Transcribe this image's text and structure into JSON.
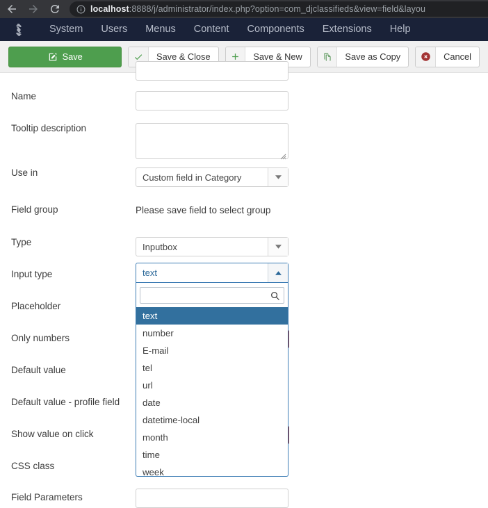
{
  "browser": {
    "back_icon": "back-arrow-icon",
    "forward_icon": "forward-arrow-icon",
    "reload_icon": "reload-icon",
    "info_icon": "info-circle-icon",
    "url_host": "localhost",
    "url_rest": ":8888/j/administrator/index.php?option=com_djclassifieds&view=field&layou"
  },
  "admin_menu": {
    "logo": "joomla-logo-icon",
    "items": [
      {
        "label": "System"
      },
      {
        "label": "Users"
      },
      {
        "label": "Menus"
      },
      {
        "label": "Content"
      },
      {
        "label": "Components"
      },
      {
        "label": "Extensions"
      },
      {
        "label": "Help"
      }
    ]
  },
  "toolbar": {
    "save_label": "Save",
    "save_close_label": "Save & Close",
    "save_new_label": "Save & New",
    "save_copy_label": "Save as Copy",
    "cancel_label": "Cancel",
    "save_icon": "pencil-square-icon",
    "save_close_icon": "check-icon",
    "save_new_icon": "plus-icon",
    "save_copy_icon": "copy-icon",
    "cancel_icon": "cancel-circle-icon",
    "save_color": "#4e9e4e",
    "cancel_color": "#a33434"
  },
  "form": {
    "rows": [
      {
        "label": "Name",
        "value": ""
      },
      {
        "label": "Tooltip description",
        "value": ""
      },
      {
        "label": "Use in",
        "value": "Custom field in Category"
      },
      {
        "label": "Field group",
        "note": "Please save field to select group"
      },
      {
        "label": "Type",
        "value": "Inputbox"
      },
      {
        "label": "Input type",
        "value": "text"
      },
      {
        "label": "Placeholder",
        "value": ""
      },
      {
        "label": "Only numbers",
        "value": ""
      },
      {
        "label": "Default value",
        "value": ""
      },
      {
        "label": "Default value - profile field",
        "value": ""
      },
      {
        "label": "Show value on click",
        "value": ""
      },
      {
        "label": "CSS class",
        "value": ""
      },
      {
        "label": "Field Parameters",
        "value": ""
      }
    ]
  },
  "input_type_dropdown": {
    "selected": "text",
    "search_value": "",
    "search_placeholder": "",
    "search_icon": "magnifier-icon",
    "arrow_icon": "chevron-up-icon",
    "highlight_color": "#32709e",
    "options": [
      {
        "label": "text",
        "selected": true
      },
      {
        "label": "number",
        "selected": false
      },
      {
        "label": "E-mail",
        "selected": false
      },
      {
        "label": "tel",
        "selected": false
      },
      {
        "label": "url",
        "selected": false
      },
      {
        "label": "date",
        "selected": false
      },
      {
        "label": "datetime-local",
        "selected": false
      },
      {
        "label": "month",
        "selected": false
      },
      {
        "label": "time",
        "selected": false
      },
      {
        "label": "week",
        "selected": false
      }
    ]
  }
}
